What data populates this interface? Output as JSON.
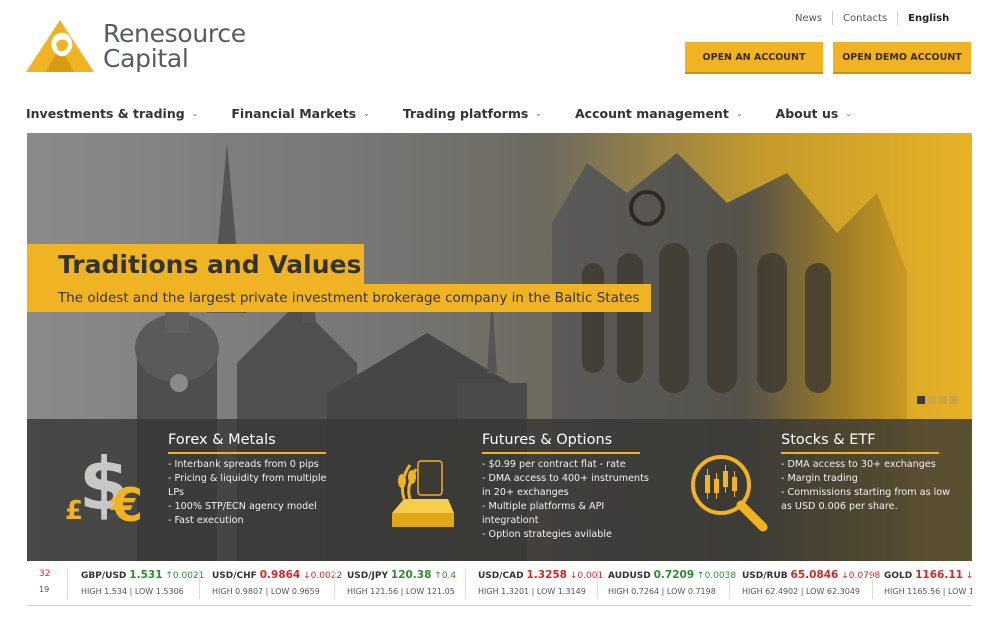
{
  "brand": {
    "line1": "Renesource",
    "line2": "Capital",
    "color": "#f0b323"
  },
  "topbar": {
    "links": [
      "News",
      "Contacts",
      "English"
    ]
  },
  "actions": {
    "open_account": "OPEN AN ACCOUNT",
    "open_demo": "OPEN DEMO ACCOUNT"
  },
  "nav": {
    "items": [
      "Investments & trading",
      "Financial Markets",
      "Trading platforms",
      "Account management",
      "About us"
    ]
  },
  "hero": {
    "title": "Traditions and Values",
    "subtitle": "The oldest and the largest private investment brokerage company in the Baltic States",
    "slides": 4,
    "active_slide": 1
  },
  "features": [
    {
      "title": "Forex & Metals",
      "icon": "currency-icon",
      "items": [
        "- Interbank spreads from 0 pips",
        "- Pricing & liquidity from multiple",
        "LPs",
        "- 100% STP/ECN agency model",
        "- Fast execution"
      ]
    },
    {
      "title": "Futures & Options",
      "icon": "commodities-icon",
      "items": [
        "- $0.99 per contract flat - rate",
        "- DMA access to 400+ instruments",
        "in 20+ exchanges",
        "- Multiple platforms & API",
        "integrationt",
        "- Option strategies avilable"
      ]
    },
    {
      "title": "Stocks & ETF",
      "icon": "candlestick-magnifier-icon",
      "items": [
        "- DMA access to 30+ exchanges",
        "- Margin trading",
        "- Commissions starting from as low",
        "as USD 0.006 per share."
      ]
    }
  ],
  "ticker": {
    "partial_left": {
      "top": "32",
      "bottom": "19"
    },
    "quotes": [
      {
        "symbol": "GBP/USD",
        "value": "1.531",
        "change": "0.0021",
        "dir": "up",
        "high": "HIGH 1.534",
        "low": "LOW 1.5306"
      },
      {
        "symbol": "USD/CHF",
        "value": "0.9864",
        "change": "0.0022",
        "dir": "down",
        "high": "HIGH 0.9807",
        "low": "LOW 0.9659"
      },
      {
        "symbol": "USD/JPY",
        "value": "120.38",
        "change": "0.4",
        "dir": "up",
        "high": "HIGH 121.56",
        "low": "LOW 121.05"
      },
      {
        "symbol": "USD/CAD",
        "value": "1.3258",
        "change": "0.001",
        "dir": "down",
        "high": "HIGH 1.3201",
        "low": "LOW 1.3149"
      },
      {
        "symbol": "AUDUSD",
        "value": "0.7209",
        "change": "0.0038",
        "dir": "up",
        "high": "HIGH 0.7264",
        "low": "LOW 0.7198"
      },
      {
        "symbol": "USD/RUB",
        "value": "65.0846",
        "change": "0.0798",
        "dir": "down",
        "high": "HIGH 62.4902",
        "low": "LOW 62.3049"
      },
      {
        "symbol": "GOLD",
        "value": "1166.11",
        "change": "",
        "dir": "down",
        "high": "HIGH 1165.56",
        "low": "LOW 1"
      }
    ]
  }
}
